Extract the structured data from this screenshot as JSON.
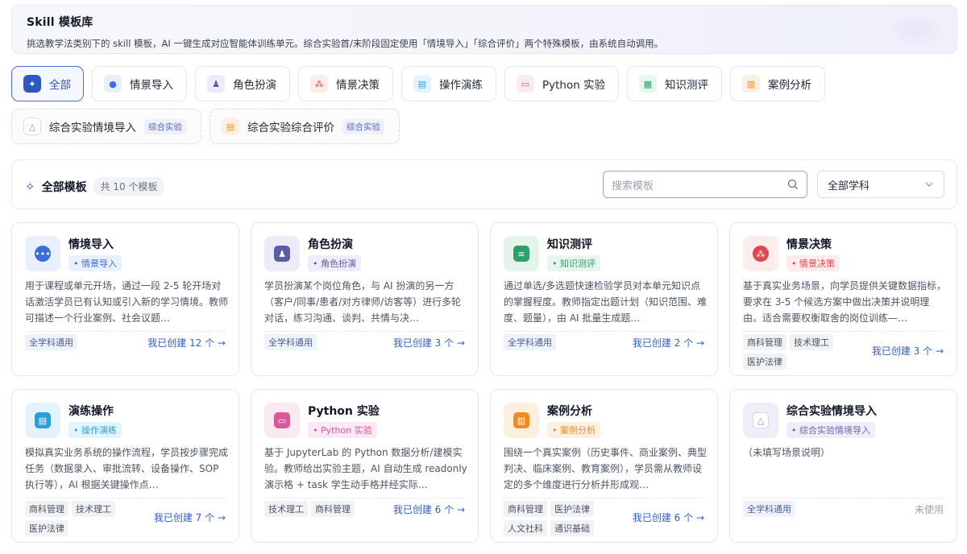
{
  "header": {
    "title": "Skill 模板库",
    "description": "挑选教学法类别下的 skill 模板，AI 一键生成对应智能体训练单元。综合实验首/末阶段固定使用「情境导入」「综合评价」两个特殊模板，由系统自动调用。"
  },
  "categories": [
    {
      "label": "全部",
      "icon": "magic-wand-icon",
      "color": "#2f57c4"
    },
    {
      "label": "情景导入",
      "icon": "chat-bubble-icon",
      "color": "#3b6fd8"
    },
    {
      "label": "角色扮演",
      "icon": "person-icon",
      "color": "#5b5ea6"
    },
    {
      "label": "情景决策",
      "icon": "decision-icon",
      "color": "#e0474c"
    },
    {
      "label": "操作演练",
      "icon": "screen-icon",
      "color": "#2a9fd8"
    },
    {
      "label": "Python 实验",
      "icon": "code-window-icon",
      "color": "#d9579a"
    },
    {
      "label": "知识测评",
      "icon": "clipboard-icon",
      "color": "#2c9f6b"
    },
    {
      "label": "案例分析",
      "icon": "document-icon",
      "color": "#ef8a1d"
    }
  ],
  "special_categories": [
    {
      "label": "综合实验情境导入",
      "badge": "综合实验",
      "icon": "network-icon",
      "color": "#8a86c8"
    },
    {
      "label": "综合实验综合评价",
      "badge": "综合实验",
      "icon": "report-icon",
      "color": "#ef9b20"
    }
  ],
  "list": {
    "title": "全部模板",
    "count": "共 10 个模板",
    "search_placeholder": "搜索模板",
    "subject_filter": "全部学科"
  },
  "cards": [
    {
      "name": "情境导入",
      "type": "• 情景导入",
      "desc": "用于课程或单元开场，通过一段 2-5 轮开场对话激活学员已有认知或引入新的学习情境。教师可描述一个行业案例、社会议题…",
      "tags": [
        "全学科通用"
      ],
      "link": "我已创建 12 个 →",
      "icon": "chat-bubble-icon"
    },
    {
      "name": "角色扮演",
      "type": "• 角色扮演",
      "desc": "学员扮演某个岗位角色，与 AI 扮演的另一方（客户/同事/患者/对方律师/访客等）进行多轮对话，练习沟通、谈判、共情与决…",
      "tags": [
        "全学科通用"
      ],
      "link": "我已创建 3 个 →",
      "icon": "person-icon"
    },
    {
      "name": "知识测评",
      "type": "• 知识测评",
      "desc": "通过单选/多选题快速检验学员对本单元知识点的掌握程度。教师指定出题计划（知识范围、难度、题量），由 AI 批量生成题…",
      "tags": [
        "全学科通用"
      ],
      "link": "我已创建 2 个 →",
      "icon": "clipboard-icon"
    },
    {
      "name": "情景决策",
      "type": "• 情景决策",
      "desc": "基于真实业务场景，向学员提供关键数据指标，要求在 3-5 个候选方案中做出决策并说明理由。适合需要权衡取舍的岗位训练—…",
      "tags": [
        "商科管理",
        "技术理工",
        "医护法律"
      ],
      "link": "我已创建 3 个 →",
      "icon": "decision-icon"
    },
    {
      "name": "演练操作",
      "type": "• 操作演练",
      "desc": "模拟真实业务系统的操作流程，学员按步骤完成任务（数据录入、审批流转、设备操作、SOP 执行等），AI 根据关键操作点…",
      "tags": [
        "商科管理",
        "技术理工",
        "医护法律"
      ],
      "link": "我已创建 7 个 →",
      "icon": "screen-icon"
    },
    {
      "name": "Python 实验",
      "type": "• Python 实验",
      "desc": "基于 JupyterLab 的 Python 数据分析/建模实验。教师给出实验主题，AI 自动生成 readonly 演示格 + task 学生动手格并经实际…",
      "tags": [
        "技术理工",
        "商科管理"
      ],
      "link": "我已创建 6 个 →",
      "icon": "code-window-icon"
    },
    {
      "name": "案例分析",
      "type": "• 案例分析",
      "desc": "围绕一个真实案例（历史事件、商业案例、典型判决、临床案例、教育案例），学员需从教师设定的多个维度进行分析并形成观…",
      "tags": [
        "商科管理",
        "医护法律",
        "人文社科",
        "通识基础"
      ],
      "link": "我已创建 6 个 →",
      "icon": "document-icon"
    },
    {
      "name": "综合实验情境导入",
      "type": "• 综合实验情境导入",
      "desc": "（未填写场景说明）",
      "tags": [
        "全学科通用"
      ],
      "link": "未使用",
      "icon": "network-icon"
    }
  ],
  "colors": {
    "accent": "#2f57c4",
    "link": "#2f5fc7"
  }
}
